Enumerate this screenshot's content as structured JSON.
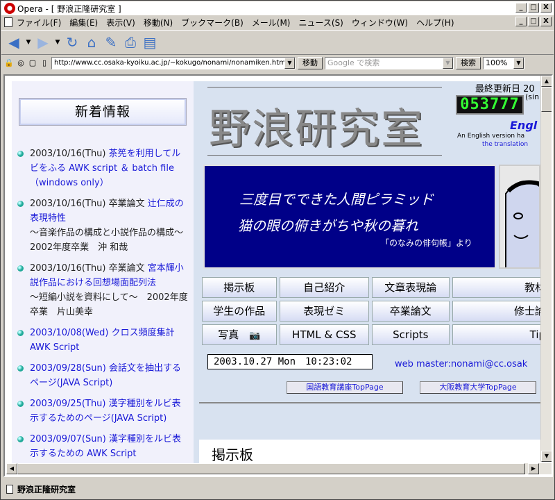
{
  "window": {
    "title": "Opera - [ 野浪正隆研究室 ]",
    "min": "_",
    "max": "□",
    "close": "X"
  },
  "menu": [
    "ファイル(F)",
    "編集(E)",
    "表示(V)",
    "移動(N)",
    "ブックマーク(B)",
    "メール(M)",
    "ニュース(S)",
    "ウィンドウ(W)",
    "ヘルプ(H)"
  ],
  "address": {
    "url": "http://www.cc.osaka-kyoiku.ac.jp/~kokugo/nonami/nonamiken.html",
    "go": "移動",
    "search_placeholder": "Google で検索",
    "search_btn": "検索",
    "zoom": "100%"
  },
  "sidebar": {
    "heading": "新着情報",
    "news": [
      {
        "date": "2003/10/16(Thu)",
        "link": "茶筅を利用してルビをふる AWK script ＆ batch file（windows only）",
        "sub": ""
      },
      {
        "date": "2003/10/16(Thu) 卒業論文",
        "link": "辻仁成の表現特性",
        "sub": "〜音楽作品の構成と小説作品の構成〜　2002年度卒業　沖 和哉"
      },
      {
        "date": "2003/10/16(Thu) 卒業論文",
        "link": "宮本輝小説作品における回想場面配列法",
        "sub": "〜短編小説を資料にして〜　2002年度卒業　片山美幸"
      },
      {
        "date": "2003/10/08(Wed)",
        "link": "クロス頻度集計 AWK Script",
        "sub": ""
      },
      {
        "date": "2003/09/28(Sun)",
        "link": "会話文を抽出するページ(JAVA Script)",
        "sub": ""
      },
      {
        "date": "2003/09/25(Thu)",
        "link": "漢字種別をルビ表示するためのページ(JAVA Script)",
        "sub": ""
      },
      {
        "date": "2003/09/07(Sun)",
        "link": "漢字種別をルビ表示するための AWK Script",
        "sub": ""
      }
    ]
  },
  "header": {
    "title": "野浪研究室",
    "updated": "最終更新日 20",
    "counter": "053777",
    "kin": "(sin",
    "english": "Engl",
    "english_sub": "An English version ha",
    "english_sub2": "the translation"
  },
  "banner": {
    "line1": "三度目でできた人間ピラミッド",
    "line2": "猫の眼の俯きがちや秋の暮れ",
    "source": "「のなみの俳句帳」より"
  },
  "nav": [
    [
      "掲示板",
      "自己紹介",
      "文章表現論",
      "教材"
    ],
    [
      "学生の作品",
      "表現ゼミ",
      "卒業論文",
      "修士論"
    ],
    [
      "写真",
      "HTML & CSS",
      "Scripts",
      "Tip"
    ]
  ],
  "clock": "2003.10.27 Mon　10:23:02",
  "webmaster": "web master:nonami@cc.osak",
  "links": {
    "kokugo": "国語教育講座TopPage",
    "osaka": "大阪教育大学TopPage"
  },
  "section": "掲示板",
  "status": "野浪正隆研究室"
}
